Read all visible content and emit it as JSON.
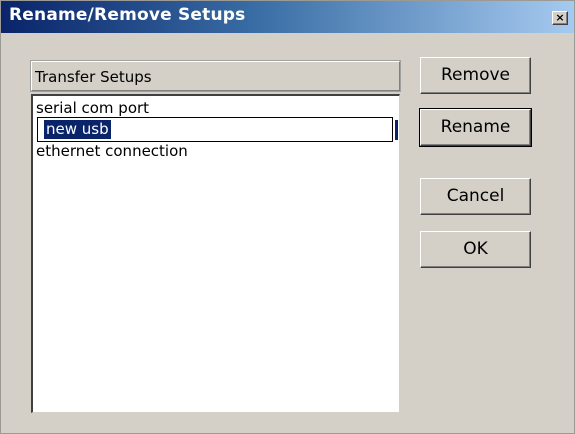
{
  "window": {
    "title": "Rename/Remove Setups",
    "close_label": "×"
  },
  "list": {
    "header": "Transfer Setups",
    "items": [
      {
        "label": "serial com port"
      },
      {
        "label": "new usb"
      },
      {
        "label": "ethernet connection"
      }
    ],
    "editing_index": 1,
    "edit_value": "new usb"
  },
  "buttons": {
    "remove": "Remove",
    "rename": "Rename",
    "cancel": "Cancel",
    "ok": "OK"
  },
  "colors": {
    "title_gradient_start": "#0a246a",
    "title_gradient_end": "#a6caf0",
    "dialog_face": "#d4d0c8",
    "selection": "#0a246a"
  }
}
